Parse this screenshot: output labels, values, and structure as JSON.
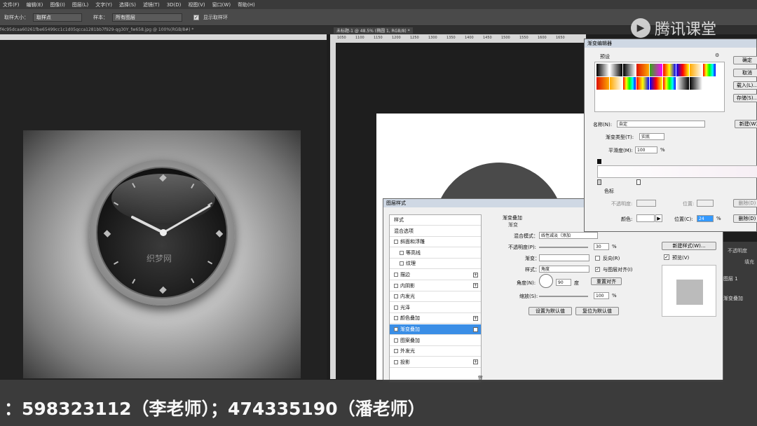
{
  "menu": [
    "文件(F)",
    "编辑(E)",
    "图像(I)",
    "图层(L)",
    "文字(Y)",
    "选择(S)",
    "滤镜(T)",
    "3D(D)",
    "视图(V)",
    "窗口(W)",
    "帮助(H)"
  ],
  "options": {
    "size_label": "取样大小：",
    "size_value": "取样点",
    "sample_label": "样本：",
    "sample_value": "所有图层",
    "ring_label": "显示取样环"
  },
  "tabs": {
    "left": "f4c95dcaa60261fbe65499cc1c1d05qcca1281bb7f929-qg30Y_fw658.jpg @ 100%(RGB/8#) *",
    "right": "未标题-1 @ 48.5% (椭圆 1, RGB/8) *"
  },
  "ruler_ticks": [
    "1050",
    "1100",
    "1150",
    "1200",
    "1250",
    "1300",
    "1350",
    "1400",
    "1450",
    "1500",
    "1550",
    "1600",
    "1650"
  ],
  "clock": {
    "watermark": "织梦网"
  },
  "layer_style": {
    "title": "图层样式",
    "items": [
      {
        "label": "样式",
        "check": false,
        "plus": false,
        "indent": false
      },
      {
        "label": "混合选项",
        "check": false,
        "plus": false,
        "indent": false
      },
      {
        "label": "斜面和浮雕",
        "check": true,
        "plus": false,
        "indent": false
      },
      {
        "label": "等高线",
        "check": true,
        "plus": false,
        "indent": true
      },
      {
        "label": "纹理",
        "check": true,
        "plus": false,
        "indent": true
      },
      {
        "label": "描边",
        "check": true,
        "plus": true,
        "indent": false
      },
      {
        "label": "内阴影",
        "check": true,
        "plus": true,
        "indent": false
      },
      {
        "label": "内发光",
        "check": true,
        "plus": false,
        "indent": false
      },
      {
        "label": "光泽",
        "check": true,
        "plus": false,
        "indent": false
      },
      {
        "label": "颜色叠加",
        "check": true,
        "plus": true,
        "indent": false
      },
      {
        "label": "渐变叠加",
        "check": true,
        "plus": true,
        "indent": false,
        "selected": true
      },
      {
        "label": "图案叠加",
        "check": true,
        "plus": false,
        "indent": false
      },
      {
        "label": "外发光",
        "check": true,
        "plus": false,
        "indent": false
      },
      {
        "label": "投影",
        "check": true,
        "plus": true,
        "indent": false
      }
    ],
    "section": "渐变叠加",
    "subsection": "渐变",
    "blend_label": "混合模式：",
    "blend_value": "线性减淡（添加",
    "opacity_label": "不透明度(P):",
    "opacity_value": "30",
    "percent": "%",
    "gradient_label": "渐变：",
    "reverse_label": "反向(R)",
    "style_label": "样式：",
    "style_value": "角度",
    "align_label": "与图层对齐(I)",
    "angle_label": "角度(N):",
    "angle_value": "90",
    "degree": "度",
    "reset_align": "重置对齐",
    "scale_label": "缩放(S):",
    "scale_value": "100",
    "make_default": "设置为默认值",
    "reset_default": "复位为默认值",
    "new_style": "新建样式(W)...",
    "preview_label": "预览(V)"
  },
  "gradient_editor": {
    "title": "渐变编辑器",
    "presets_label": "预设",
    "ok": "确定",
    "cancel": "取消",
    "load": "载入(L)...",
    "save": "存储(S)...",
    "name_label": "名称(N):",
    "name_value": "自定",
    "new": "新建(W)",
    "type_label": "渐变类型(T):",
    "type_value": "实底",
    "smooth_label": "平滑度(M):",
    "smooth_value": "100",
    "percent": "%",
    "stops_label": "色标",
    "opacity_label": "不透明度:",
    "location_label": "位置:",
    "delete_label": "删除(D)",
    "color_label": "颜色:",
    "location2_label": "位置(C):",
    "location2_value": "24"
  },
  "layers_panel": {
    "item1": "不透明度",
    "item2": "填充",
    "layer": "图层 1",
    "effect": "渐变叠加"
  },
  "watermark": "腾讯课堂",
  "caption": "：598323112（李老师）；474335190（潘老师）"
}
